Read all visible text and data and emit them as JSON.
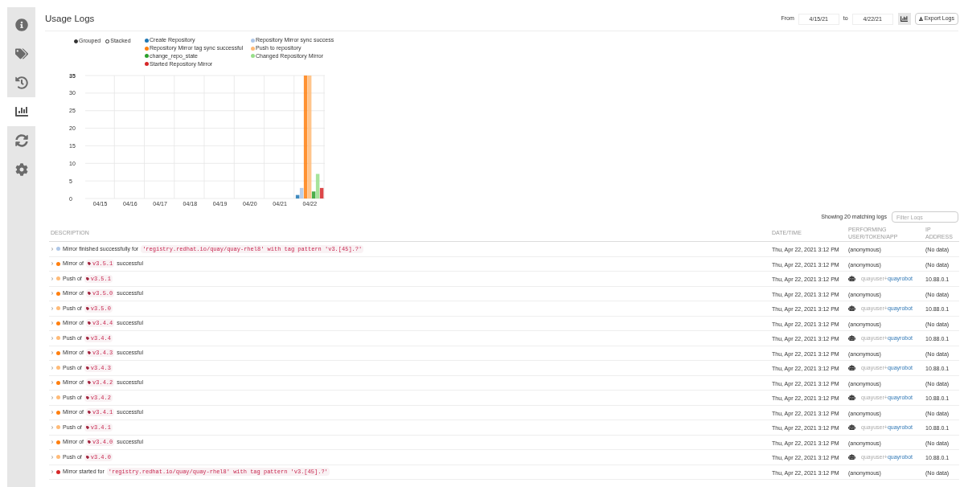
{
  "sidebar": {
    "items": [
      {
        "kind": "info",
        "selected": false
      },
      {
        "kind": "tags",
        "selected": false
      },
      {
        "kind": "history",
        "selected": false
      },
      {
        "kind": "usage",
        "selected": true
      },
      {
        "kind": "mirror",
        "selected": false
      },
      {
        "kind": "settings",
        "selected": false
      }
    ]
  },
  "header": {
    "title": "Usage Logs",
    "from_label": "From",
    "from_value": "4/15/21",
    "to_label": "to",
    "to_value": "4/22/21",
    "chart_toggle_on": true,
    "export_label": "Export Logs"
  },
  "chart": {
    "modes": [
      {
        "label": "Grouped",
        "selected": true
      },
      {
        "label": "Stacked",
        "selected": false
      }
    ],
    "chart_data": {
      "type": "bar",
      "categories": [
        "04/15",
        "04/16",
        "04/17",
        "04/18",
        "04/19",
        "04/20",
        "04/21",
        "04/22"
      ],
      "grid": true,
      "ylim": [
        0,
        35
      ],
      "yticks": [
        0,
        5,
        10,
        15,
        20,
        25,
        30,
        35
      ],
      "stacked": false,
      "series": [
        {
          "name": "Create Repository",
          "color": "#1f77b4",
          "values": [
            0,
            0,
            0,
            0,
            0,
            0,
            0,
            1
          ]
        },
        {
          "name": "Repository Mirror sync success",
          "color": "#aec7e8",
          "values": [
            0,
            0,
            0,
            0,
            0,
            0,
            0,
            3
          ]
        },
        {
          "name": "Repository Mirror tag sync successful",
          "color": "#ff7f0e",
          "values": [
            0,
            0,
            0,
            0,
            0,
            0,
            0,
            35
          ]
        },
        {
          "name": "Push to repository",
          "color": "#ffbb78",
          "values": [
            0,
            0,
            0,
            0,
            0,
            0,
            0,
            35
          ]
        },
        {
          "name": "change_repo_state",
          "color": "#2ca02c",
          "values": [
            0,
            0,
            0,
            0,
            0,
            0,
            0,
            2
          ]
        },
        {
          "name": "Changed Repository Mirror",
          "color": "#98df8a",
          "values": [
            0,
            0,
            0,
            0,
            0,
            0,
            0,
            7
          ]
        },
        {
          "name": "Started Repository Mirror",
          "color": "#d62728",
          "values": [
            0,
            0,
            0,
            0,
            0,
            0,
            0,
            3
          ]
        }
      ]
    }
  },
  "logs": {
    "count_text": "Showing 20 matching logs",
    "filter_placeholder": "Filter Logs",
    "columns": [
      "DESCRIPTION",
      "DATE/TIME",
      "PERFORMING USER/TOKEN/APP",
      "IP ADDRESS"
    ],
    "rows": [
      {
        "color": "#aec7e8",
        "before": "Mirror finished successfully for",
        "kind": "code",
        "value": "'registry.redhat.io/quay/quay-rhel8' with tag pattern 'v3.[45].?'",
        "datetime": "Thu, Apr 22, 2021 3:12 PM",
        "performer": {
          "kind": "anonymous",
          "text": "(anonymous)"
        },
        "ip": "(No data)"
      },
      {
        "color": "#ff7f0e",
        "before": "Mirror of",
        "kind": "tag",
        "value": "v3.5.1",
        "after": "successful",
        "datetime": "Thu, Apr 22, 2021 3:12 PM",
        "performer": {
          "kind": "anonymous",
          "text": "(anonymous)"
        },
        "ip": "(No data)"
      },
      {
        "color": "#ffbb78",
        "before": "Push of",
        "kind": "tag",
        "value": "v3.5.1",
        "datetime": "Thu, Apr 22, 2021 3:12 PM",
        "performer": {
          "kind": "robot",
          "user": "quayuser+",
          "robot": "quayrobot"
        },
        "ip": "10.88.0.1"
      },
      {
        "color": "#ff7f0e",
        "before": "Mirror of",
        "kind": "tag",
        "value": "v3.5.0",
        "after": "successful",
        "datetime": "Thu, Apr 22, 2021 3:12 PM",
        "performer": {
          "kind": "anonymous",
          "text": "(anonymous)"
        },
        "ip": "(No data)"
      },
      {
        "color": "#ffbb78",
        "before": "Push of",
        "kind": "tag",
        "value": "v3.5.0",
        "datetime": "Thu, Apr 22, 2021 3:12 PM",
        "performer": {
          "kind": "robot",
          "user": "quayuser+",
          "robot": "quayrobot"
        },
        "ip": "10.88.0.1"
      },
      {
        "color": "#ff7f0e",
        "before": "Mirror of",
        "kind": "tag",
        "value": "v3.4.4",
        "after": "successful",
        "datetime": "Thu, Apr 22, 2021 3:12 PM",
        "performer": {
          "kind": "anonymous",
          "text": "(anonymous)"
        },
        "ip": "(No data)"
      },
      {
        "color": "#ffbb78",
        "before": "Push of",
        "kind": "tag",
        "value": "v3.4.4",
        "datetime": "Thu, Apr 22, 2021 3:12 PM",
        "performer": {
          "kind": "robot",
          "user": "quayuser+",
          "robot": "quayrobot"
        },
        "ip": "10.88.0.1"
      },
      {
        "color": "#ff7f0e",
        "before": "Mirror of",
        "kind": "tag",
        "value": "v3.4.3",
        "after": "successful",
        "datetime": "Thu, Apr 22, 2021 3:12 PM",
        "performer": {
          "kind": "anonymous",
          "text": "(anonymous)"
        },
        "ip": "(No data)"
      },
      {
        "color": "#ffbb78",
        "before": "Push of",
        "kind": "tag",
        "value": "v3.4.3",
        "datetime": "Thu, Apr 22, 2021 3:12 PM",
        "performer": {
          "kind": "robot",
          "user": "quayuser+",
          "robot": "quayrobot"
        },
        "ip": "10.88.0.1"
      },
      {
        "color": "#ff7f0e",
        "before": "Mirror of",
        "kind": "tag",
        "value": "v3.4.2",
        "after": "successful",
        "datetime": "Thu, Apr 22, 2021 3:12 PM",
        "performer": {
          "kind": "anonymous",
          "text": "(anonymous)"
        },
        "ip": "(No data)"
      },
      {
        "color": "#ffbb78",
        "before": "Push of",
        "kind": "tag",
        "value": "v3.4.2",
        "datetime": "Thu, Apr 22, 2021 3:12 PM",
        "performer": {
          "kind": "robot",
          "user": "quayuser+",
          "robot": "quayrobot"
        },
        "ip": "10.88.0.1"
      },
      {
        "color": "#ff7f0e",
        "before": "Mirror of",
        "kind": "tag",
        "value": "v3.4.1",
        "after": "successful",
        "datetime": "Thu, Apr 22, 2021 3:12 PM",
        "performer": {
          "kind": "anonymous",
          "text": "(anonymous)"
        },
        "ip": "(No data)"
      },
      {
        "color": "#ffbb78",
        "before": "Push of",
        "kind": "tag",
        "value": "v3.4.1",
        "datetime": "Thu, Apr 22, 2021 3:12 PM",
        "performer": {
          "kind": "robot",
          "user": "quayuser+",
          "robot": "quayrobot"
        },
        "ip": "10.88.0.1"
      },
      {
        "color": "#ff7f0e",
        "before": "Mirror of",
        "kind": "tag",
        "value": "v3.4.0",
        "after": "successful",
        "datetime": "Thu, Apr 22, 2021 3:12 PM",
        "performer": {
          "kind": "anonymous",
          "text": "(anonymous)"
        },
        "ip": "(No data)"
      },
      {
        "color": "#ffbb78",
        "before": "Push of",
        "kind": "tag",
        "value": "v3.4.0",
        "datetime": "Thu, Apr 22, 2021 3:12 PM",
        "performer": {
          "kind": "robot",
          "user": "quayuser+",
          "robot": "quayrobot"
        },
        "ip": "10.88.0.1"
      },
      {
        "color": "#d62728",
        "before": "Mirror started for",
        "kind": "code",
        "value": "'registry.redhat.io/quay/quay-rhel8' with tag pattern 'v3.[45].?'",
        "datetime": "Thu, Apr 22, 2021 3:12 PM",
        "performer": {
          "kind": "anonymous",
          "text": "(anonymous)"
        },
        "ip": "(No data)"
      }
    ]
  }
}
